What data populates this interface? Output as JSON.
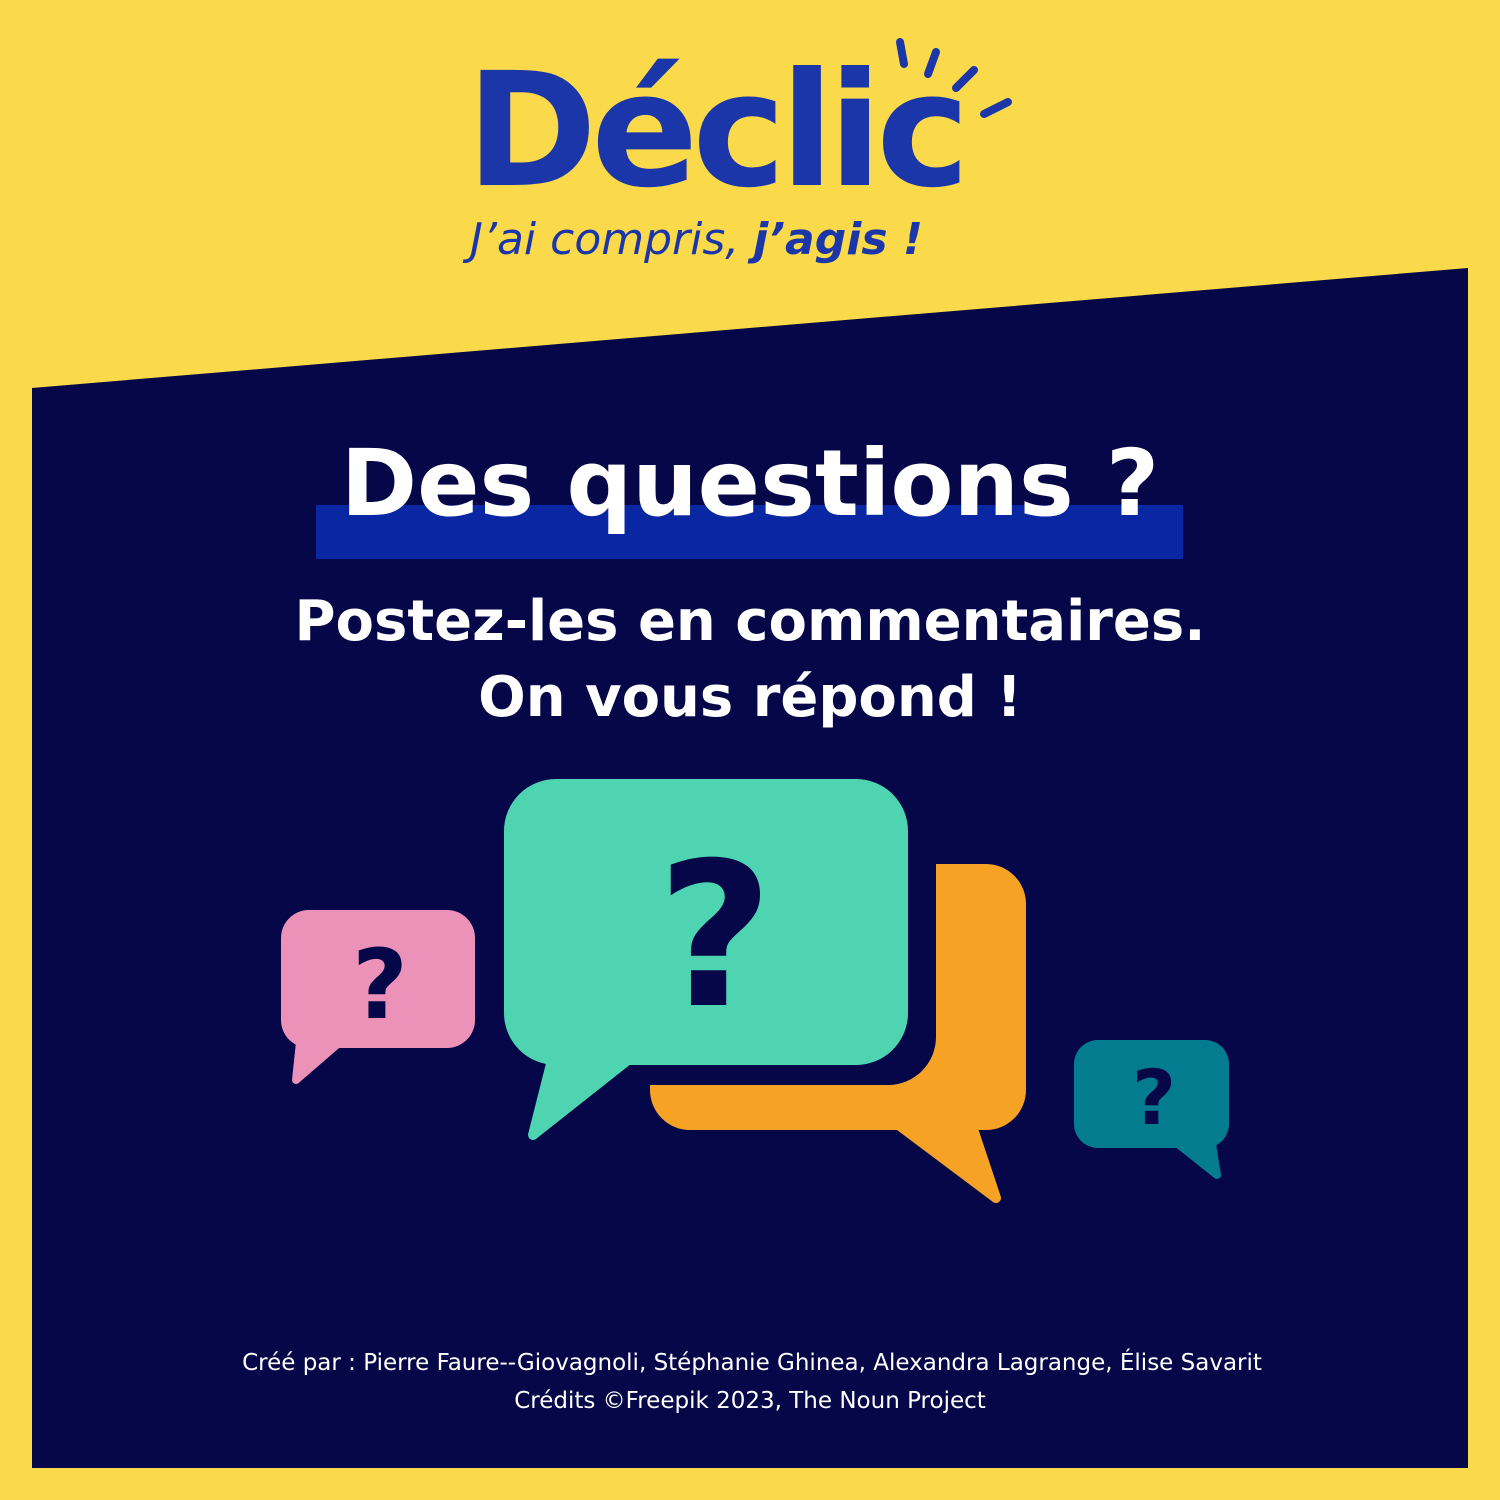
{
  "logo": {
    "name": "Déclic",
    "tagline_regular": "J’ai compris, ",
    "tagline_bold": "j’agis !"
  },
  "headline": "Des questions ?",
  "subtitle_line1": "Postez-les en commentaires.",
  "subtitle_line2": "On vous répond !",
  "bubbles": {
    "pink_symbol": "?",
    "green_symbol": "?",
    "teal_symbol": "?"
  },
  "credits": {
    "authors": "Créé par : Pierre Faure--Giovagnoli, Stéphanie Ghinea,  Alexandra Lagrange, Élise Savarit",
    "sources": "Crédits ©Freepik 2023, The Noun Project"
  },
  "colors": {
    "background_yellow": "#fad94a",
    "panel_navy": "#050748",
    "brand_blue": "#1a36a8",
    "highlight_blue": "#0a27a3",
    "bubble_pink": "#ec92b9",
    "bubble_green": "#4fd4b2",
    "bubble_orange": "#f5a225",
    "bubble_teal": "#047c8f"
  }
}
